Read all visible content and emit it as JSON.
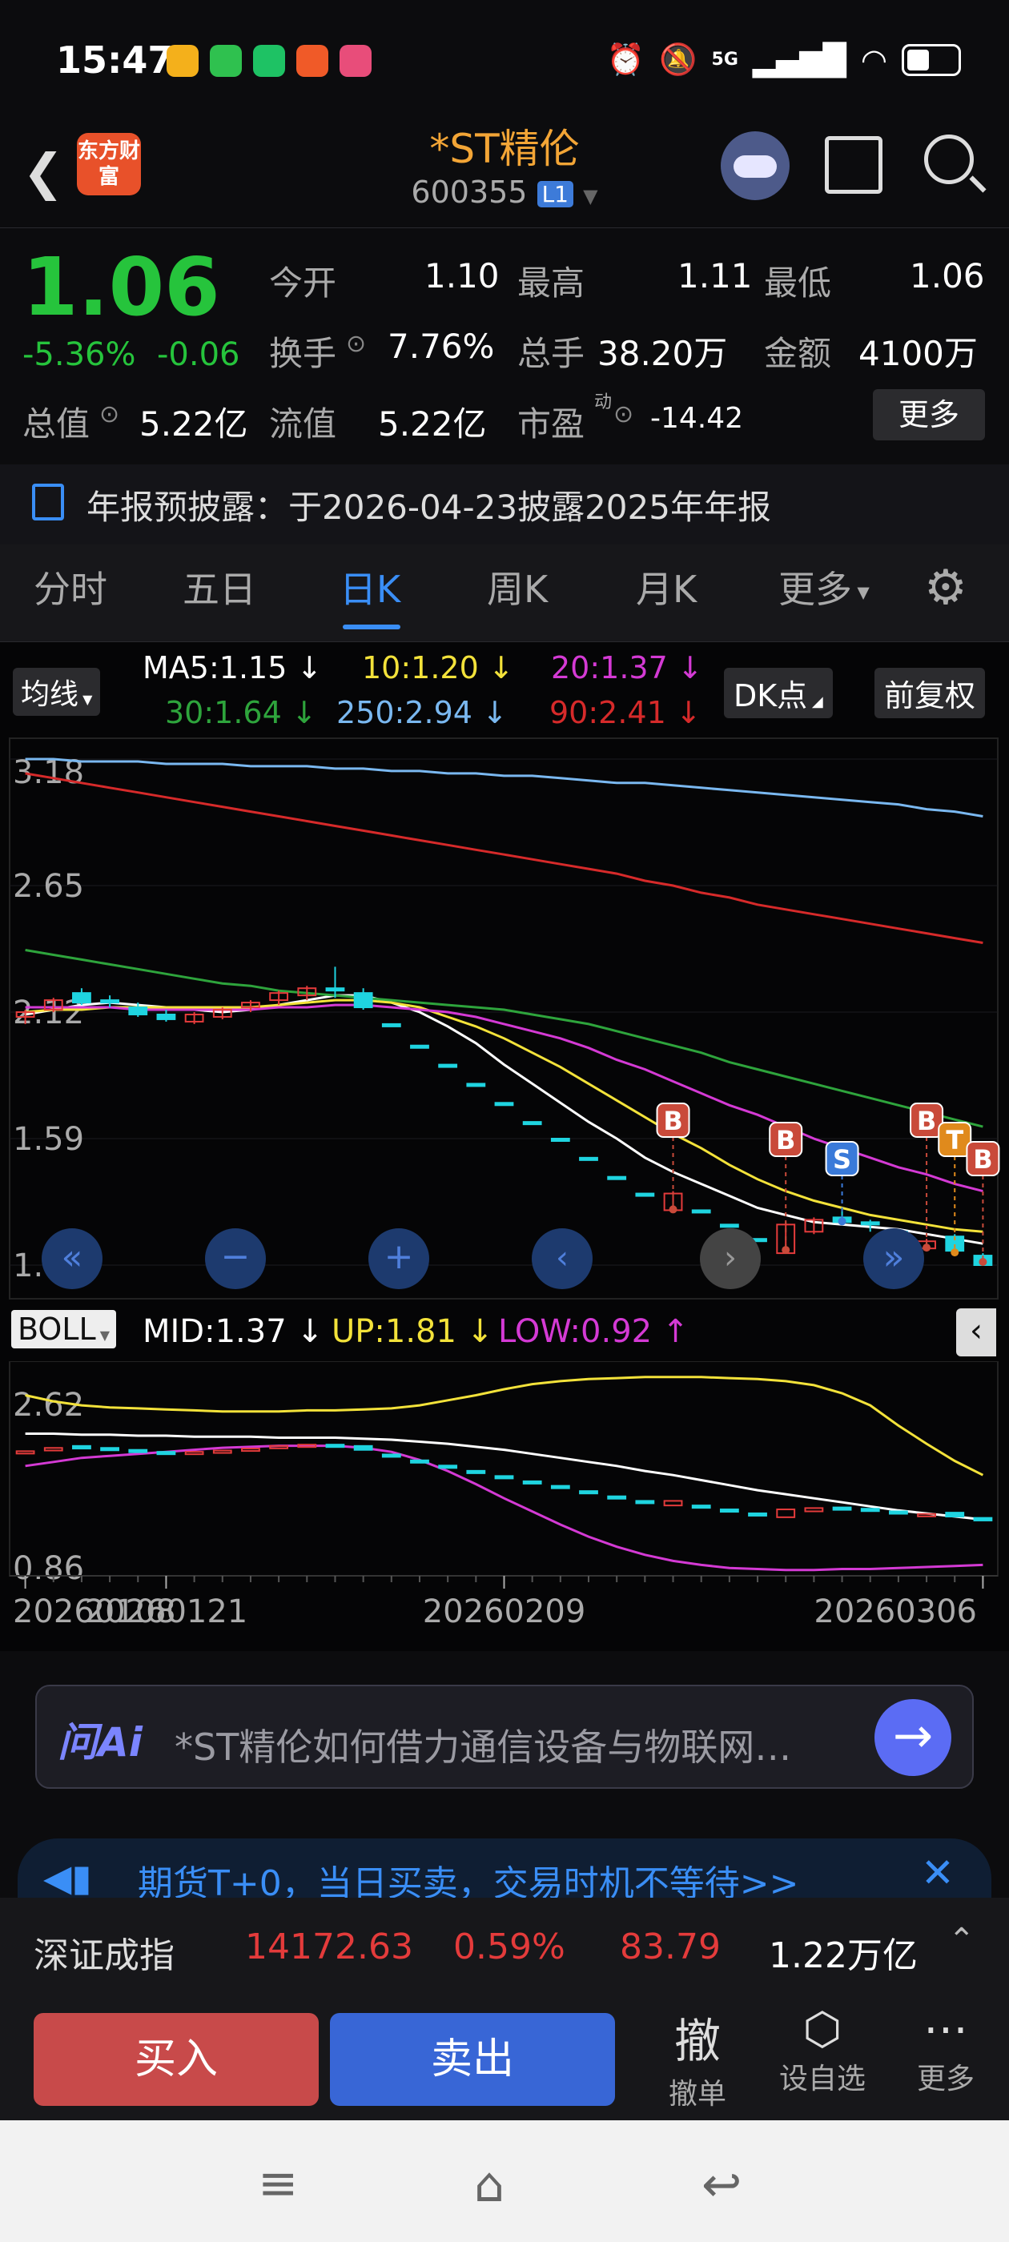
{
  "status_bar": {
    "time": "15:47",
    "network": "5G",
    "app_icon_colors": [
      "#f4b01b",
      "#2fc14f",
      "#1ec264",
      "#f05a28",
      "#e84d7a"
    ]
  },
  "header": {
    "logo_text": "东方财富",
    "title": "*ST精伦",
    "code": "600355",
    "level_badge": "L1"
  },
  "quote": {
    "price": "1.06",
    "change_pct": "-5.36%",
    "change": "-0.06",
    "open_label": "今开",
    "open": "1.10",
    "high_label": "最高",
    "high": "1.11",
    "low_label": "最低",
    "low": "1.06",
    "turnover_label": "换手",
    "turnover": "7.76%",
    "volume_label": "总手",
    "volume": "38.20万",
    "amount_label": "金额",
    "amount": "4100万",
    "mktcap_label": "总值",
    "mktcap": "5.22亿",
    "float_label": "流值",
    "float": "5.22亿",
    "pe_label": "市盈",
    "pe_sup": "动",
    "pe": "-14.42",
    "more_label": "更多"
  },
  "notice": {
    "text": "年报预披露：于2026-04-23披露2025年年报"
  },
  "tabs": [
    {
      "label": "分时"
    },
    {
      "label": "五日"
    },
    {
      "label": "日K",
      "active": true
    },
    {
      "label": "周K"
    },
    {
      "label": "月K"
    },
    {
      "label": "更多"
    }
  ],
  "ma_bar": {
    "selector": "均线",
    "ma5": "MA5:1.15 ↓",
    "ma10": "10:1.20 ↓",
    "ma20": "20:1.37 ↓",
    "ma30": "30:1.64 ↓",
    "ma250": "250:2.94 ↓",
    "ma90": "90:2.41 ↓",
    "dk": "DK点",
    "adjust": "前复权"
  },
  "colors": {
    "ma5": "#ffffff",
    "ma10": "#f3e23a",
    "ma20": "#d43ad4",
    "ma30": "#2ea43c",
    "ma90": "#d62a2a",
    "ma250": "#7ab8f0",
    "up": "#e43b3b",
    "down": "#1fd4e0"
  },
  "boll_bar": {
    "selector": "BOLL",
    "mid": "MID:1.37 ↓",
    "up": "UP:1.81 ↓",
    "low": "LOW:0.92 ↑"
  },
  "chart_data": [
    {
      "type": "candlestick",
      "title": "",
      "y_ticks": [
        "3.18",
        "2.65",
        "2.12",
        "1.59",
        "1.06"
      ],
      "ylim": [
        1.06,
        3.18
      ],
      "candles": [
        {
          "o": 2.1,
          "h": 2.13,
          "l": 2.07,
          "c": 2.12
        },
        {
          "o": 2.13,
          "h": 2.18,
          "l": 2.12,
          "c": 2.17
        },
        {
          "o": 2.2,
          "h": 2.22,
          "l": 2.15,
          "c": 2.16
        },
        {
          "o": 2.17,
          "h": 2.19,
          "l": 2.14,
          "c": 2.16
        },
        {
          "o": 2.14,
          "h": 2.16,
          "l": 2.1,
          "c": 2.11
        },
        {
          "o": 2.11,
          "h": 2.13,
          "l": 2.08,
          "c": 2.09
        },
        {
          "o": 2.08,
          "h": 2.12,
          "l": 2.07,
          "c": 2.11
        },
        {
          "o": 2.1,
          "h": 2.14,
          "l": 2.09,
          "c": 2.13
        },
        {
          "o": 2.14,
          "h": 2.17,
          "l": 2.12,
          "c": 2.16
        },
        {
          "o": 2.17,
          "h": 2.21,
          "l": 2.15,
          "c": 2.2
        },
        {
          "o": 2.19,
          "h": 2.23,
          "l": 2.17,
          "c": 2.22
        },
        {
          "o": 2.22,
          "h": 2.31,
          "l": 2.18,
          "c": 2.21
        },
        {
          "o": 2.2,
          "h": 2.22,
          "l": 2.13,
          "c": 2.14
        },
        {
          "o": 2.07,
          "h": 2.07,
          "l": 2.07,
          "c": 2.07
        },
        {
          "o": 1.98,
          "h": 1.98,
          "l": 1.98,
          "c": 1.98
        },
        {
          "o": 1.9,
          "h": 1.9,
          "l": 1.9,
          "c": 1.9
        },
        {
          "o": 1.82,
          "h": 1.82,
          "l": 1.82,
          "c": 1.82
        },
        {
          "o": 1.74,
          "h": 1.74,
          "l": 1.74,
          "c": 1.74
        },
        {
          "o": 1.66,
          "h": 1.66,
          "l": 1.66,
          "c": 1.66
        },
        {
          "o": 1.59,
          "h": 1.59,
          "l": 1.59,
          "c": 1.59
        },
        {
          "o": 1.51,
          "h": 1.51,
          "l": 1.51,
          "c": 1.51
        },
        {
          "o": 1.43,
          "h": 1.43,
          "l": 1.43,
          "c": 1.43
        },
        {
          "o": 1.36,
          "h": 1.36,
          "l": 1.36,
          "c": 1.36
        },
        {
          "o": 1.29,
          "h": 1.37,
          "l": 1.28,
          "c": 1.36
        },
        {
          "o": 1.29,
          "h": 1.29,
          "l": 1.29,
          "c": 1.29
        },
        {
          "o": 1.23,
          "h": 1.23,
          "l": 1.23,
          "c": 1.23
        },
        {
          "o": 1.17,
          "h": 1.17,
          "l": 1.17,
          "c": 1.17
        },
        {
          "o": 1.11,
          "h": 1.24,
          "l": 1.11,
          "c": 1.23
        },
        {
          "o": 1.2,
          "h": 1.26,
          "l": 1.19,
          "c": 1.25
        },
        {
          "o": 1.26,
          "h": 1.3,
          "l": 1.23,
          "c": 1.24
        },
        {
          "o": 1.24,
          "h": 1.25,
          "l": 1.2,
          "c": 1.23
        },
        {
          "o": 1.2,
          "h": 1.2,
          "l": 1.17,
          "c": 1.17
        },
        {
          "o": 1.13,
          "h": 1.17,
          "l": 1.12,
          "c": 1.16
        },
        {
          "o": 1.18,
          "h": 1.19,
          "l": 1.1,
          "c": 1.12
        },
        {
          "o": 1.1,
          "h": 1.11,
          "l": 1.06,
          "c": 1.06
        }
      ],
      "markers": [
        {
          "index": 23,
          "label": "B",
          "color": "#c94a3a"
        },
        {
          "index": 27,
          "label": "B",
          "color": "#c94a3a"
        },
        {
          "index": 29,
          "label": "S",
          "color": "#3a7ad9"
        },
        {
          "index": 32,
          "label": "B",
          "color": "#c94a3a"
        },
        {
          "index": 33,
          "label": "T",
          "color": "#e08a1c"
        },
        {
          "index": 34,
          "label": "B",
          "color": "#c94a3a"
        }
      ],
      "series": [
        {
          "name": "MA5",
          "values": [
            2.11,
            2.13,
            2.15,
            2.16,
            2.15,
            2.14,
            2.13,
            2.12,
            2.13,
            2.15,
            2.17,
            2.19,
            2.19,
            2.16,
            2.12,
            2.06,
            1.99,
            1.9,
            1.82,
            1.74,
            1.66,
            1.59,
            1.51,
            1.45,
            1.4,
            1.35,
            1.3,
            1.27,
            1.24,
            1.23,
            1.22,
            1.21,
            1.19,
            1.17,
            1.15
          ]
        },
        {
          "name": "MA10",
          "values": [
            2.12,
            2.13,
            2.13,
            2.14,
            2.14,
            2.14,
            2.14,
            2.14,
            2.14,
            2.15,
            2.16,
            2.17,
            2.17,
            2.16,
            2.14,
            2.1,
            2.06,
            2.01,
            1.95,
            1.89,
            1.82,
            1.75,
            1.68,
            1.61,
            1.55,
            1.48,
            1.42,
            1.37,
            1.33,
            1.3,
            1.27,
            1.25,
            1.23,
            1.21,
            1.2
          ]
        },
        {
          "name": "MA20",
          "values": [
            2.14,
            2.14,
            2.14,
            2.14,
            2.13,
            2.13,
            2.13,
            2.13,
            2.13,
            2.14,
            2.14,
            2.15,
            2.15,
            2.14,
            2.13,
            2.12,
            2.1,
            2.07,
            2.04,
            2.01,
            1.97,
            1.92,
            1.88,
            1.83,
            1.78,
            1.73,
            1.69,
            1.64,
            1.59,
            1.55,
            1.51,
            1.47,
            1.44,
            1.4,
            1.37
          ]
        },
        {
          "name": "MA30",
          "values": [
            2.38,
            2.36,
            2.34,
            2.32,
            2.3,
            2.28,
            2.26,
            2.24,
            2.23,
            2.21,
            2.2,
            2.19,
            2.18,
            2.17,
            2.16,
            2.15,
            2.14,
            2.13,
            2.11,
            2.09,
            2.07,
            2.04,
            2.01,
            1.98,
            1.95,
            1.91,
            1.88,
            1.85,
            1.82,
            1.79,
            1.76,
            1.73,
            1.7,
            1.67,
            1.64
          ]
        },
        {
          "name": "MA90",
          "values": [
            3.12,
            3.1,
            3.08,
            3.06,
            3.04,
            3.02,
            3.0,
            2.98,
            2.96,
            2.94,
            2.92,
            2.9,
            2.88,
            2.86,
            2.84,
            2.82,
            2.8,
            2.78,
            2.76,
            2.74,
            2.72,
            2.7,
            2.67,
            2.65,
            2.62,
            2.6,
            2.57,
            2.55,
            2.53,
            2.51,
            2.49,
            2.47,
            2.45,
            2.43,
            2.41
          ]
        },
        {
          "name": "MA250",
          "values": [
            3.18,
            3.18,
            3.17,
            3.17,
            3.17,
            3.16,
            3.16,
            3.16,
            3.15,
            3.15,
            3.15,
            3.14,
            3.14,
            3.13,
            3.13,
            3.12,
            3.12,
            3.11,
            3.11,
            3.1,
            3.09,
            3.08,
            3.08,
            3.07,
            3.06,
            3.05,
            3.04,
            3.03,
            3.02,
            3.01,
            3.0,
            2.99,
            2.97,
            2.96,
            2.94
          ]
        }
      ]
    },
    {
      "type": "line",
      "title": "",
      "y_ticks": [
        "2.62",
        "0.86"
      ],
      "ylim": [
        0.86,
        2.62
      ],
      "x_ticks": [
        "20260108",
        "20260121",
        "20260209",
        "20260306"
      ],
      "series": [
        {
          "name": "UP",
          "values": [
            2.6,
            2.54,
            2.5,
            2.48,
            2.47,
            2.46,
            2.45,
            2.44,
            2.44,
            2.44,
            2.45,
            2.45,
            2.46,
            2.47,
            2.5,
            2.55,
            2.6,
            2.66,
            2.71,
            2.74,
            2.76,
            2.77,
            2.78,
            2.78,
            2.78,
            2.77,
            2.76,
            2.74,
            2.7,
            2.62,
            2.5,
            2.3,
            2.12,
            1.95,
            1.81
          ]
        },
        {
          "name": "MID",
          "values": [
            2.22,
            2.22,
            2.21,
            2.21,
            2.2,
            2.2,
            2.19,
            2.19,
            2.19,
            2.18,
            2.18,
            2.18,
            2.17,
            2.16,
            2.14,
            2.12,
            2.09,
            2.06,
            2.02,
            1.98,
            1.94,
            1.9,
            1.85,
            1.81,
            1.76,
            1.71,
            1.66,
            1.62,
            1.58,
            1.54,
            1.5,
            1.46,
            1.43,
            1.4,
            1.37
          ]
        },
        {
          "name": "LOW",
          "values": [
            1.9,
            1.94,
            1.98,
            2.0,
            2.02,
            2.04,
            2.06,
            2.08,
            2.09,
            2.1,
            2.1,
            2.1,
            2.08,
            2.04,
            1.96,
            1.85,
            1.72,
            1.58,
            1.45,
            1.32,
            1.2,
            1.1,
            1.02,
            0.96,
            0.92,
            0.89,
            0.88,
            0.87,
            0.87,
            0.88,
            0.88,
            0.89,
            0.9,
            0.91,
            0.92
          ]
        }
      ]
    }
  ],
  "ai_bar": {
    "logo": "问Ai",
    "question": "*ST精伦如何借力通信设备与物联网…"
  },
  "ad_bar": {
    "text": "期货T+0，当日买卖，交易时机不等待>>"
  },
  "index_bar": {
    "name": "深证成指",
    "value": "14172.63",
    "pct": "0.59%",
    "change": "83.79",
    "amount": "1.22万亿"
  },
  "bottom_bar": {
    "buy": "买入",
    "sell": "卖出",
    "cancel_big": "撤",
    "cancel": "撤单",
    "watch": "设自选",
    "more": "更多"
  }
}
